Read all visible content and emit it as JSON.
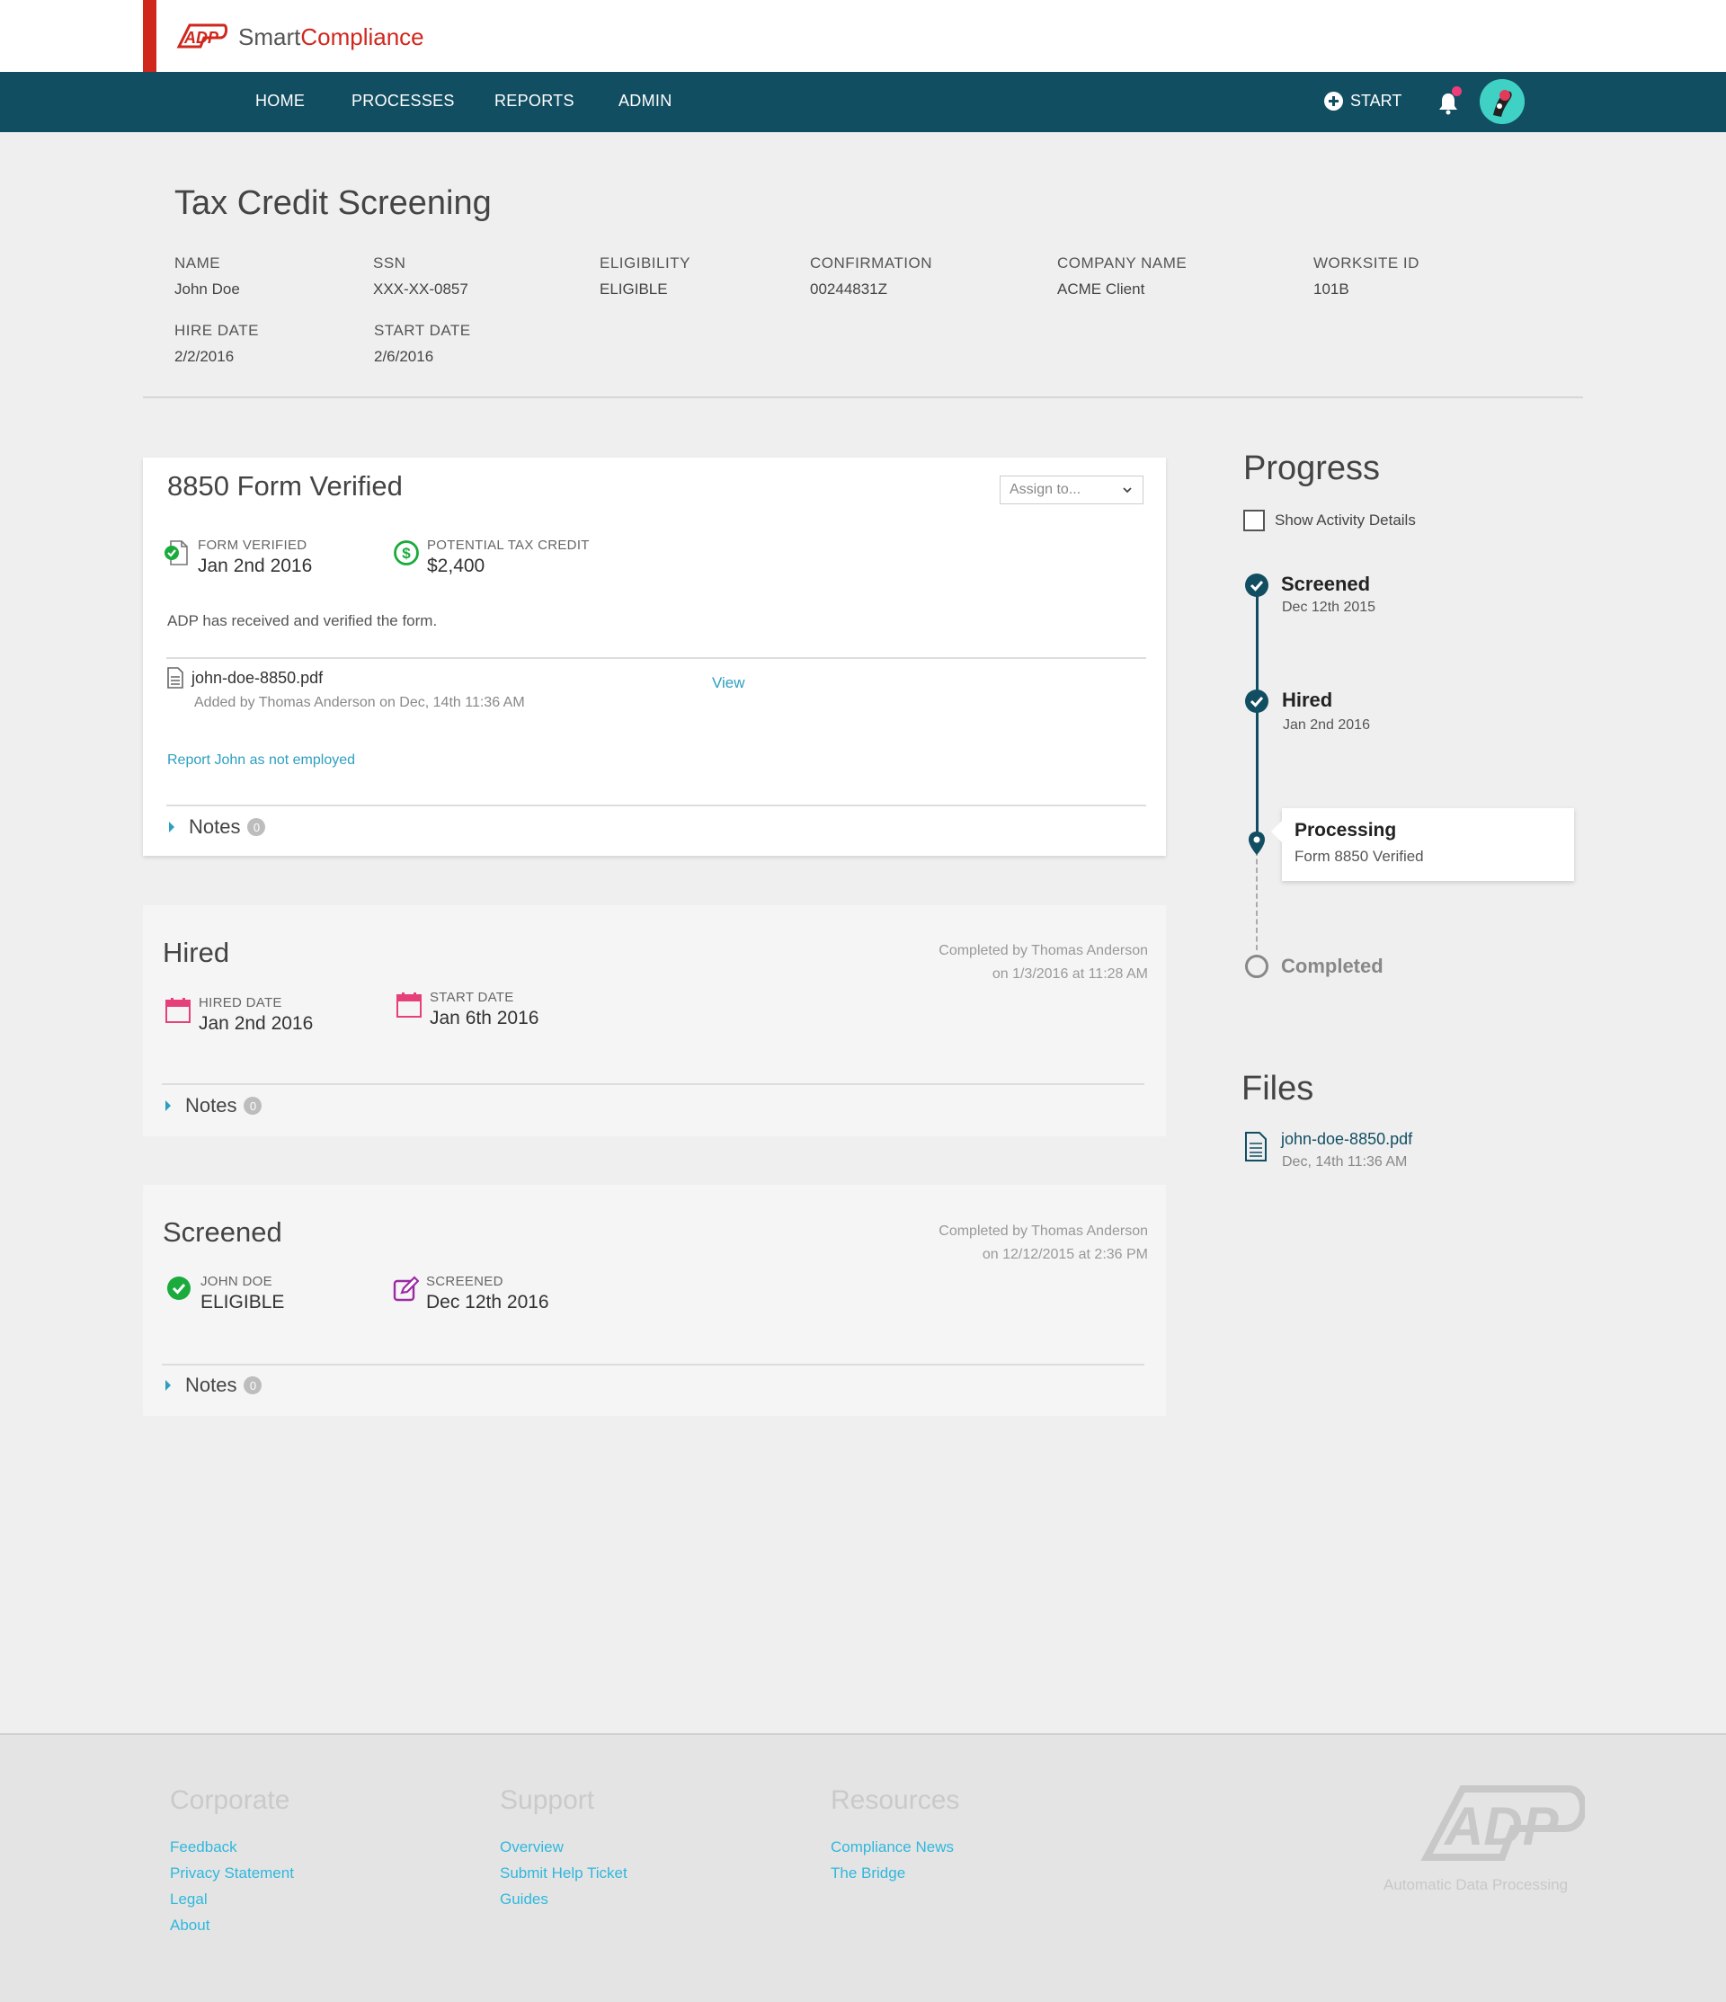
{
  "brand": {
    "logo_text": "ADP",
    "name_prefix": "Smart",
    "name_suffix": "Compliance"
  },
  "nav": {
    "items": [
      "HOME",
      "PROCESSES",
      "REPORTS",
      "ADMIN"
    ],
    "start_label": "START"
  },
  "header": {
    "title": "Tax Credit Screening",
    "fields": [
      {
        "label": "NAME",
        "value": "John Doe"
      },
      {
        "label": "SSN",
        "value": "XXX-XX-0857"
      },
      {
        "label": "ELIGIBILITY",
        "value": "ELIGIBLE"
      },
      {
        "label": "CONFIRMATION",
        "value": "00244831Z"
      },
      {
        "label": "COMPANY NAME",
        "value": "ACME Client"
      },
      {
        "label": "WORKSITE ID",
        "value": "101B"
      },
      {
        "label": "HIRE DATE",
        "value": "2/2/2016"
      },
      {
        "label": "START DATE",
        "value": "2/6/2016"
      }
    ]
  },
  "card_form": {
    "title": "8850 Form Verified",
    "assign_placeholder": "Assign to...",
    "field1_label": "FORM VERIFIED",
    "field1_value": "Jan 2nd 2016",
    "field2_label": "POTENTIAL TAX CREDIT",
    "field2_value": "$2,400",
    "message": "ADP has received and verified the form.",
    "file_name": "john-doe-8850.pdf",
    "file_meta": "Added by Thomas Anderson on Dec, 14th 11:36 AM",
    "view_label": "View",
    "report_link": "Report John as not employed",
    "notes_label": "Notes",
    "notes_count": "0"
  },
  "card_hired": {
    "title": "Hired",
    "completed_line1": "Completed by Thomas Anderson",
    "completed_line2": "on 1/3/2016 at 11:28 AM",
    "field1_label": "HIRED DATE",
    "field1_value": "Jan 2nd 2016",
    "field2_label": "START DATE",
    "field2_value": "Jan 6th 2016",
    "notes_label": "Notes",
    "notes_count": "0"
  },
  "card_screened": {
    "title": "Screened",
    "completed_line1": "Completed by Thomas Anderson",
    "completed_line2": "on 12/12/2015 at 2:36 PM",
    "field1_label": "JOHN DOE",
    "field1_value": "ELIGIBLE",
    "field2_label": "SCREENED",
    "field2_value": "Dec 12th 2016",
    "notes_label": "Notes",
    "notes_count": "0"
  },
  "progress": {
    "title": "Progress",
    "show_details_label": "Show Activity Details",
    "steps": [
      {
        "title": "Screened",
        "sub": "Dec 12th 2015",
        "state": "done"
      },
      {
        "title": "Hired",
        "sub": "Jan 2nd 2016",
        "state": "done"
      },
      {
        "title": "Processing",
        "sub": "Form 8850 Verified",
        "state": "current"
      },
      {
        "title": "Completed",
        "sub": "",
        "state": "pending"
      }
    ]
  },
  "files": {
    "title": "Files",
    "items": [
      {
        "name": "john-doe-8850.pdf",
        "date": "Dec, 14th 11:36 AM"
      }
    ]
  },
  "footer": {
    "columns": [
      {
        "heading": "Corporate",
        "links": [
          "Feedback",
          "Privacy Statement",
          "Legal",
          "About"
        ]
      },
      {
        "heading": "Support",
        "links": [
          "Overview",
          "Submit Help Ticket",
          "Guides"
        ]
      },
      {
        "heading": "Resources",
        "links": [
          "Compliance News",
          "The Bridge"
        ]
      }
    ],
    "logo_text": "ADP",
    "tagline": "Automatic Data Processing"
  },
  "colors": {
    "nav_bg": "#124e62",
    "brand_red": "#d0271d",
    "link": "#2d9fc0",
    "success": "#1aab3c",
    "date_icon": "#e5407a",
    "edit_icon": "#9b2aa5"
  },
  "icons": [
    "plus-circle-icon",
    "bell-icon",
    "document-icon",
    "dollar-icon",
    "calendar-icon",
    "edit-icon",
    "check-circle-icon",
    "location-pin-icon",
    "chevron-down-icon"
  ]
}
